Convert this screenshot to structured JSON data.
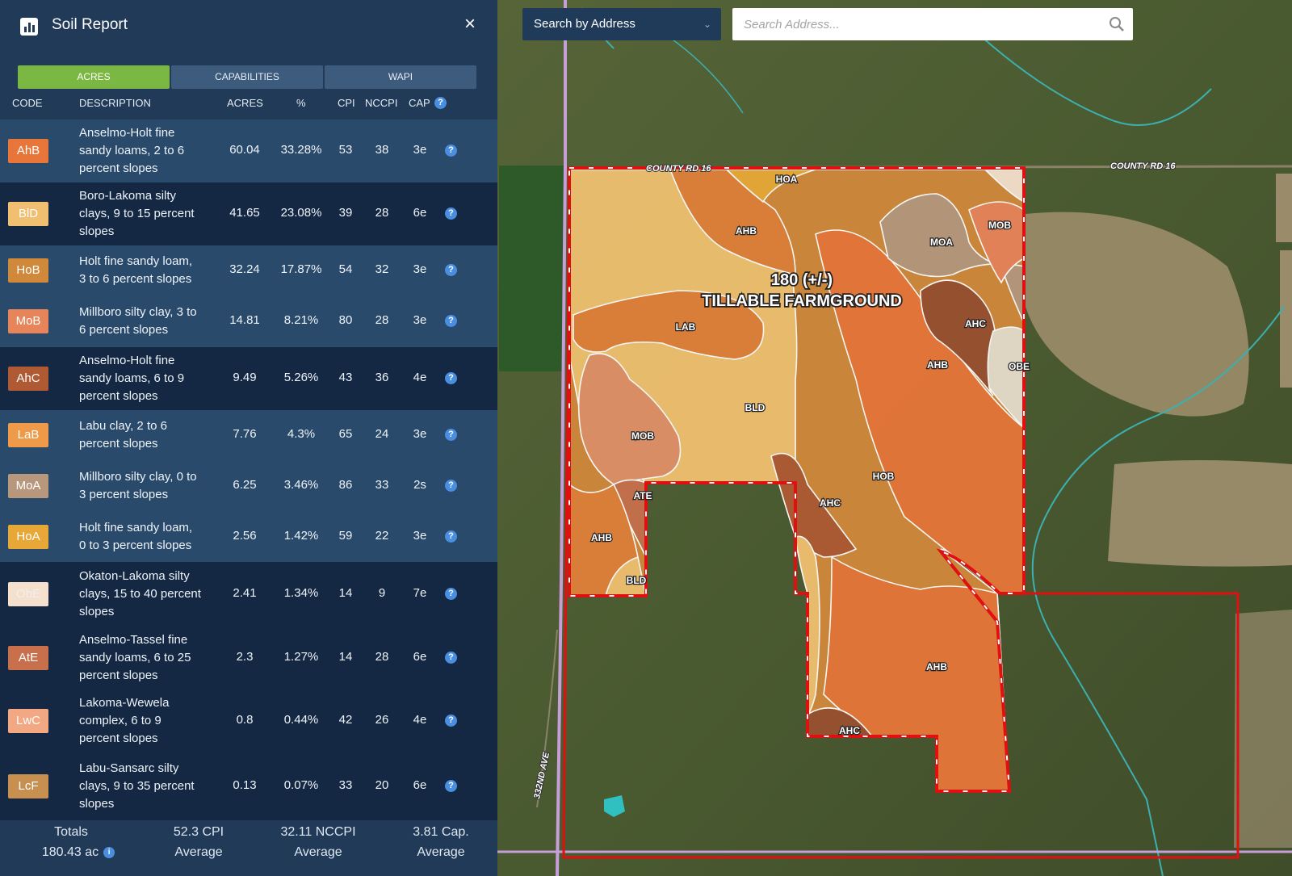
{
  "panel": {
    "title": "Soil Report",
    "close_label": "×",
    "tabs": [
      {
        "label": "ACRES",
        "active": true
      },
      {
        "label": "CAPABILITIES",
        "active": false
      },
      {
        "label": "WAPI",
        "active": false
      }
    ],
    "columns": {
      "code": "CODE",
      "description": "DESCRIPTION",
      "acres": "ACRES",
      "percent": "%",
      "cpi": "CPI",
      "nccpi": "NCCPI",
      "cap": "CAP"
    },
    "rows": [
      {
        "code": "AhB",
        "color": "#e8763a",
        "desc_lines": [
          "Anselmo-Holt fine",
          "sandy loams, 2 to 6",
          "percent slopes"
        ],
        "acres": "60.04",
        "percent": "33.28%",
        "cpi": "53",
        "nccpi": "38",
        "cap": "3e"
      },
      {
        "code": "BlD",
        "color": "#f0c070",
        "desc_lines": [
          "Boro-Lakoma silty",
          "clays, 9 to 15 percent",
          "slopes"
        ],
        "acres": "41.65",
        "percent": "23.08%",
        "cpi": "39",
        "nccpi": "28",
        "cap": "6e"
      },
      {
        "code": "HoB",
        "color": "#d0883a",
        "desc_lines": [
          "Holt fine sandy loam,",
          "3 to 6 percent slopes"
        ],
        "acres": "32.24",
        "percent": "17.87%",
        "cpi": "54",
        "nccpi": "32",
        "cap": "3e"
      },
      {
        "code": "MoB",
        "color": "#e8845a",
        "desc_lines": [
          "Millboro silty clay, 3 to",
          "6 percent slopes"
        ],
        "acres": "14.81",
        "percent": "8.21%",
        "cpi": "80",
        "nccpi": "28",
        "cap": "3e"
      },
      {
        "code": "AhC",
        "color": "#b05a34",
        "desc_lines": [
          "Anselmo-Holt fine",
          "sandy loams, 6 to 9",
          "percent slopes"
        ],
        "acres": "9.49",
        "percent": "5.26%",
        "cpi": "43",
        "nccpi": "36",
        "cap": "4e"
      },
      {
        "code": "LaB",
        "color": "#ee9a48",
        "desc_lines": [
          "Labu clay, 2 to 6",
          "percent slopes"
        ],
        "acres": "7.76",
        "percent": "4.3%",
        "cpi": "65",
        "nccpi": "24",
        "cap": "3e"
      },
      {
        "code": "MoA",
        "color": "#b8987c",
        "desc_lines": [
          "Millboro silty clay, 0 to",
          "3 percent slopes"
        ],
        "acres": "6.25",
        "percent": "3.46%",
        "cpi": "86",
        "nccpi": "33",
        "cap": "2s"
      },
      {
        "code": "HoA",
        "color": "#e8a838",
        "desc_lines": [
          "Holt fine sandy loam,",
          "0 to 3 percent slopes"
        ],
        "acres": "2.56",
        "percent": "1.42%",
        "cpi": "59",
        "nccpi": "22",
        "cap": "3e"
      },
      {
        "code": "ObE",
        "color": "#f4e0cc",
        "desc_lines": [
          "Okaton-Lakoma silty",
          "clays, 15 to 40 percent",
          "slopes"
        ],
        "acres": "2.41",
        "percent": "1.34%",
        "cpi": "14",
        "nccpi": "9",
        "cap": "7e"
      },
      {
        "code": "AtE",
        "color": "#c8704c",
        "desc_lines": [
          "Anselmo-Tassel fine",
          "sandy loams, 6 to 25",
          "percent slopes"
        ],
        "acres": "2.3",
        "percent": "1.27%",
        "cpi": "14",
        "nccpi": "28",
        "cap": "6e"
      },
      {
        "code": "LwC",
        "color": "#f2a882",
        "desc_lines": [
          "Lakoma-Wewela",
          "complex, 6 to 9",
          "percent slopes"
        ],
        "acres": "0.8",
        "percent": "0.44%",
        "cpi": "42",
        "nccpi": "26",
        "cap": "4e"
      },
      {
        "code": "LcF",
        "color": "#c89050",
        "desc_lines": [
          "Labu-Sansarc silty",
          "clays, 9 to 35 percent",
          "slopes"
        ],
        "acres": "0.13",
        "percent": "0.07%",
        "cpi": "33",
        "nccpi": "20",
        "cap": "6e"
      }
    ],
    "totals": {
      "label": "Totals",
      "acres": "180.43 ac",
      "cpi_value": "52.3 CPI",
      "cpi_label": "Average",
      "nccpi_value": "32.11 NCCPI",
      "nccpi_label": "Average",
      "cap_value": "3.81 Cap.",
      "cap_label": "Average"
    }
  },
  "search": {
    "type_label": "Search by Address",
    "placeholder": "Search Address..."
  },
  "map": {
    "field_label_1": "180 (+/-)",
    "field_label_2": "TILLABLE FARMGROUND",
    "road_east": "COUNTY RD 16",
    "road_north": "COUNTY RD 16",
    "road_west": "332ND AVE",
    "soil_labels": [
      "HOA",
      "AHB",
      "MOB",
      "MOA",
      "LAB",
      "AHC",
      "AHB",
      "OBE",
      "BLD",
      "MOB",
      "HOB",
      "ATE",
      "AHC",
      "AHB",
      "BLD",
      "AHB",
      "AHC"
    ]
  }
}
